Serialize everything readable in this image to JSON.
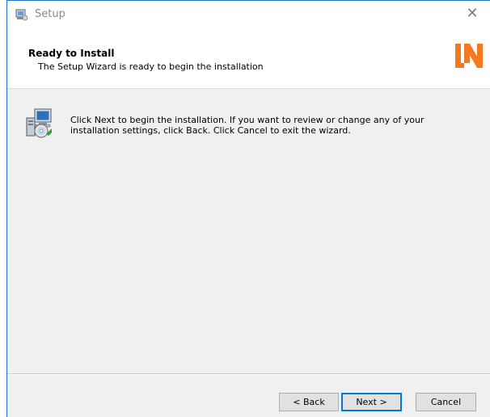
{
  "window": {
    "title": "Setup",
    "close_glyph": "✕"
  },
  "banner": {
    "title": "Ready to Install",
    "subtitle": "The Setup Wizard is ready to begin the installation",
    "logo_text": "LN",
    "logo_color": "#f47920"
  },
  "body": {
    "message": "Click Next to begin the installation. If you want to review or change any of your installation settings, click Back. Click Cancel to exit the wizard."
  },
  "buttons": {
    "back": "< Back",
    "next": "Next >",
    "cancel": "Cancel"
  },
  "icons": {
    "title": "setup-app-icon",
    "body": "computer-disc-install-icon",
    "close": "close-icon"
  }
}
